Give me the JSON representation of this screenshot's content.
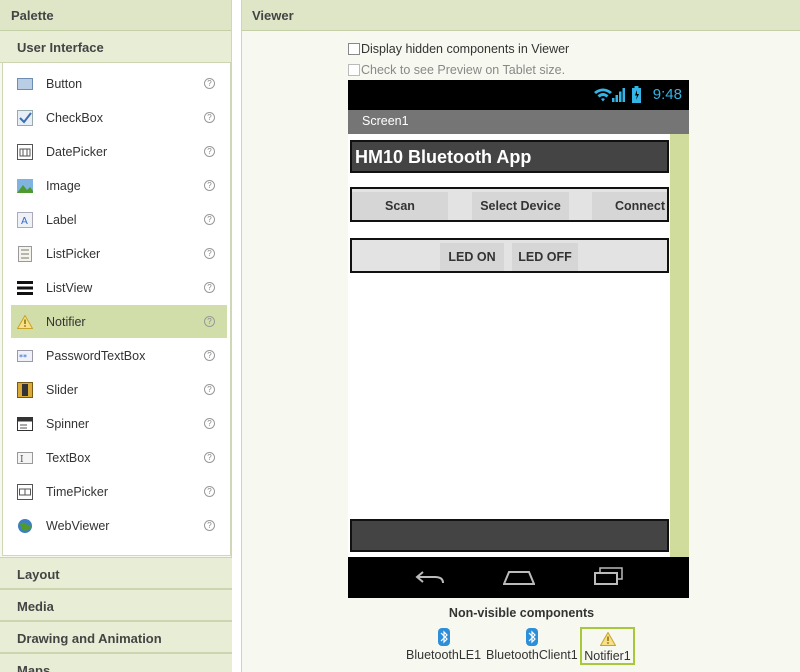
{
  "palette": {
    "title": "Palette",
    "open_category": "User Interface",
    "items": [
      {
        "label": "Button",
        "icon": "button-icon"
      },
      {
        "label": "CheckBox",
        "icon": "checkbox-icon"
      },
      {
        "label": "DatePicker",
        "icon": "datepicker-icon"
      },
      {
        "label": "Image",
        "icon": "image-icon"
      },
      {
        "label": "Label",
        "icon": "label-icon"
      },
      {
        "label": "ListPicker",
        "icon": "listpicker-icon"
      },
      {
        "label": "ListView",
        "icon": "listview-icon"
      },
      {
        "label": "Notifier",
        "icon": "notifier-icon",
        "selected": true
      },
      {
        "label": "PasswordTextBox",
        "icon": "passwordtextbox-icon"
      },
      {
        "label": "Slider",
        "icon": "slider-icon"
      },
      {
        "label": "Spinner",
        "icon": "spinner-icon"
      },
      {
        "label": "TextBox",
        "icon": "textbox-icon"
      },
      {
        "label": "TimePicker",
        "icon": "timepicker-icon"
      },
      {
        "label": "WebViewer",
        "icon": "webviewer-icon"
      }
    ],
    "help_glyph": "?",
    "categories": [
      "Layout",
      "Media",
      "Drawing and Animation",
      "Maps"
    ]
  },
  "viewer": {
    "title": "Viewer",
    "option_hidden": "Display hidden components in Viewer",
    "option_tablet": "Check to see Preview on Tablet size.",
    "status_time": "9:48",
    "screen_title": "Screen1",
    "app_title": "HM10 Bluetooth App",
    "buttons_row1": [
      "Scan",
      "Select Device",
      "Connect"
    ],
    "buttons_row2": [
      "LED ON",
      "LED OFF"
    ],
    "nonvisible_title": "Non-visible components",
    "nonvisible": [
      {
        "label": "BluetoothLE1",
        "icon": "bluetooth-icon"
      },
      {
        "label": "BluetoothClient1",
        "icon": "bluetooth-icon"
      },
      {
        "label": "Notifier1",
        "icon": "notifier-icon",
        "selected": true
      }
    ]
  },
  "colors": {
    "header_bg": "#dfe6c8",
    "selected_bg": "#d2dea9",
    "accent": "#a8c83c",
    "status_blue": "#33b5e5"
  }
}
